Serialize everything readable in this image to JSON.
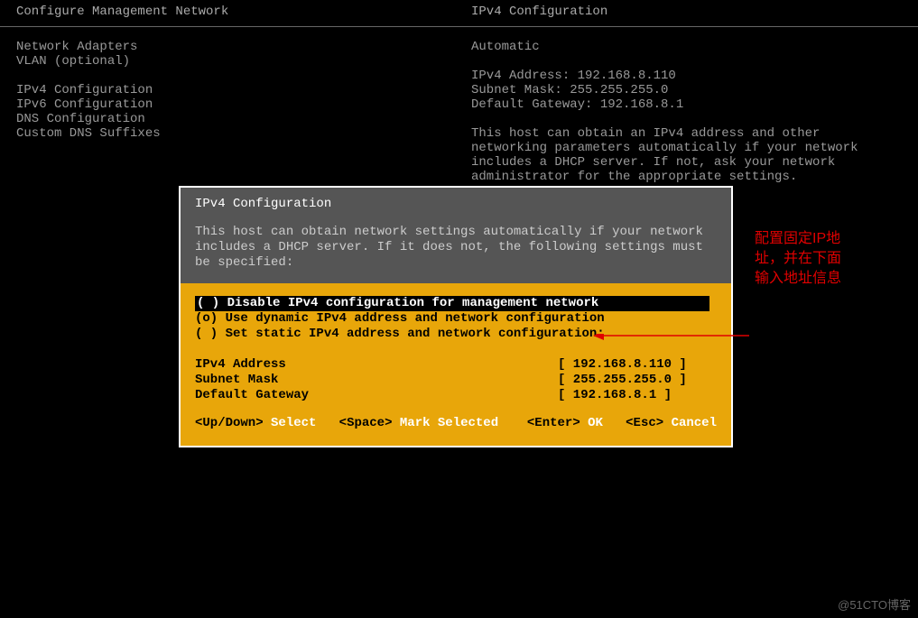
{
  "header": {
    "left": "Configure Management Network",
    "right": "IPv4 Configuration"
  },
  "menu": {
    "items1": [
      "Network Adapters",
      "VLAN (optional)"
    ],
    "items2": [
      "IPv4 Configuration",
      "IPv6 Configuration",
      "DNS Configuration",
      "Custom DNS Suffixes"
    ]
  },
  "info": {
    "mode": "Automatic",
    "addr_label": "IPv4 Address: 192.168.8.110",
    "mask_label": "Subnet Mask: 255.255.255.0",
    "gw_label": "Default Gateway: 192.168.8.1",
    "desc": "This host can obtain an IPv4 address and other networking parameters automatically if your network includes a DHCP server. If not, ask your network administrator for the appropriate settings."
  },
  "dialog": {
    "title": "IPv4 Configuration",
    "desc": "This host can obtain network settings automatically if your network includes a DHCP server. If it does not, the following settings must be specified:",
    "opt_disable": "( ) Disable IPv4 configuration for management network",
    "opt_dynamic": "(o) Use dynamic IPv4 address and network configuration",
    "opt_static": "( ) Set static IPv4 address and network configuration:",
    "fields": [
      {
        "label": "IPv4 Address",
        "value": "[ 192.168.8.110   ]"
      },
      {
        "label": "Subnet Mask",
        "value": "[ 255.255.255.0   ]"
      },
      {
        "label": "Default Gateway",
        "value": "[ 192.168.8.1     ]"
      }
    ],
    "footer": {
      "updown_key": "<Up/Down>",
      "updown_act": "Select",
      "space_key": "<Space>",
      "space_act": "Mark Selected",
      "enter_key": "<Enter>",
      "enter_act": "OK",
      "esc_key": "<Esc>",
      "esc_act": "Cancel"
    }
  },
  "annotation": "配置固定IP地\n址，并在下面\n输入地址信息",
  "watermark": "@51CTO博客"
}
